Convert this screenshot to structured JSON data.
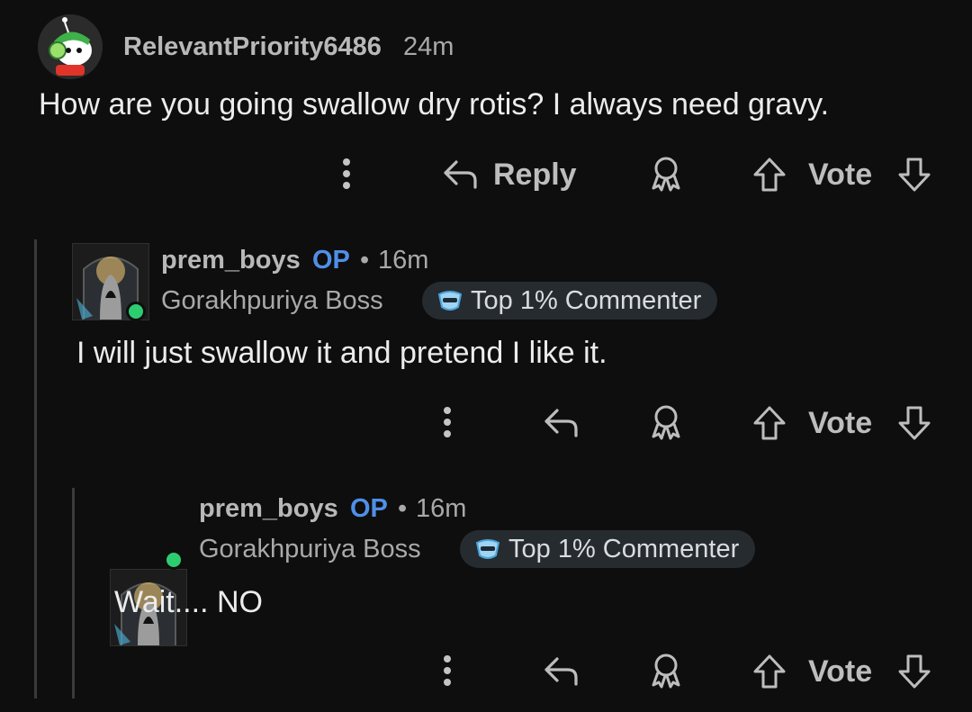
{
  "comments": [
    {
      "username": "RelevantPriority6486",
      "time": "24m",
      "body": "How are you going swallow dry rotis? I always need gravy.",
      "reply_label": "Reply",
      "vote_label": "Vote"
    },
    {
      "username": "prem_boys",
      "op_label": "OP",
      "separator": "•",
      "time": "16m",
      "flair": "Gorakhpuriya Boss",
      "badge": "Top 1% Commenter",
      "body": "I will just swallow it and pretend I like it.",
      "vote_label": "Vote"
    },
    {
      "username": "prem_boys",
      "op_label": "OP",
      "separator": "•",
      "time": "16m",
      "flair": "Gorakhpuriya Boss",
      "badge": "Top 1% Commenter",
      "body": "Wait.... NO",
      "vote_label": "Vote"
    }
  ],
  "colors": {
    "background": "#0e0e0e",
    "op": "#4f8fe8",
    "badge_bg": "#262b30",
    "online": "#2ecc71"
  },
  "icons": [
    "more-vertical-icon",
    "reply-arrow-icon",
    "award-icon",
    "upvote-arrow-icon",
    "downvote-arrow-icon",
    "commenter-badge-icon"
  ]
}
